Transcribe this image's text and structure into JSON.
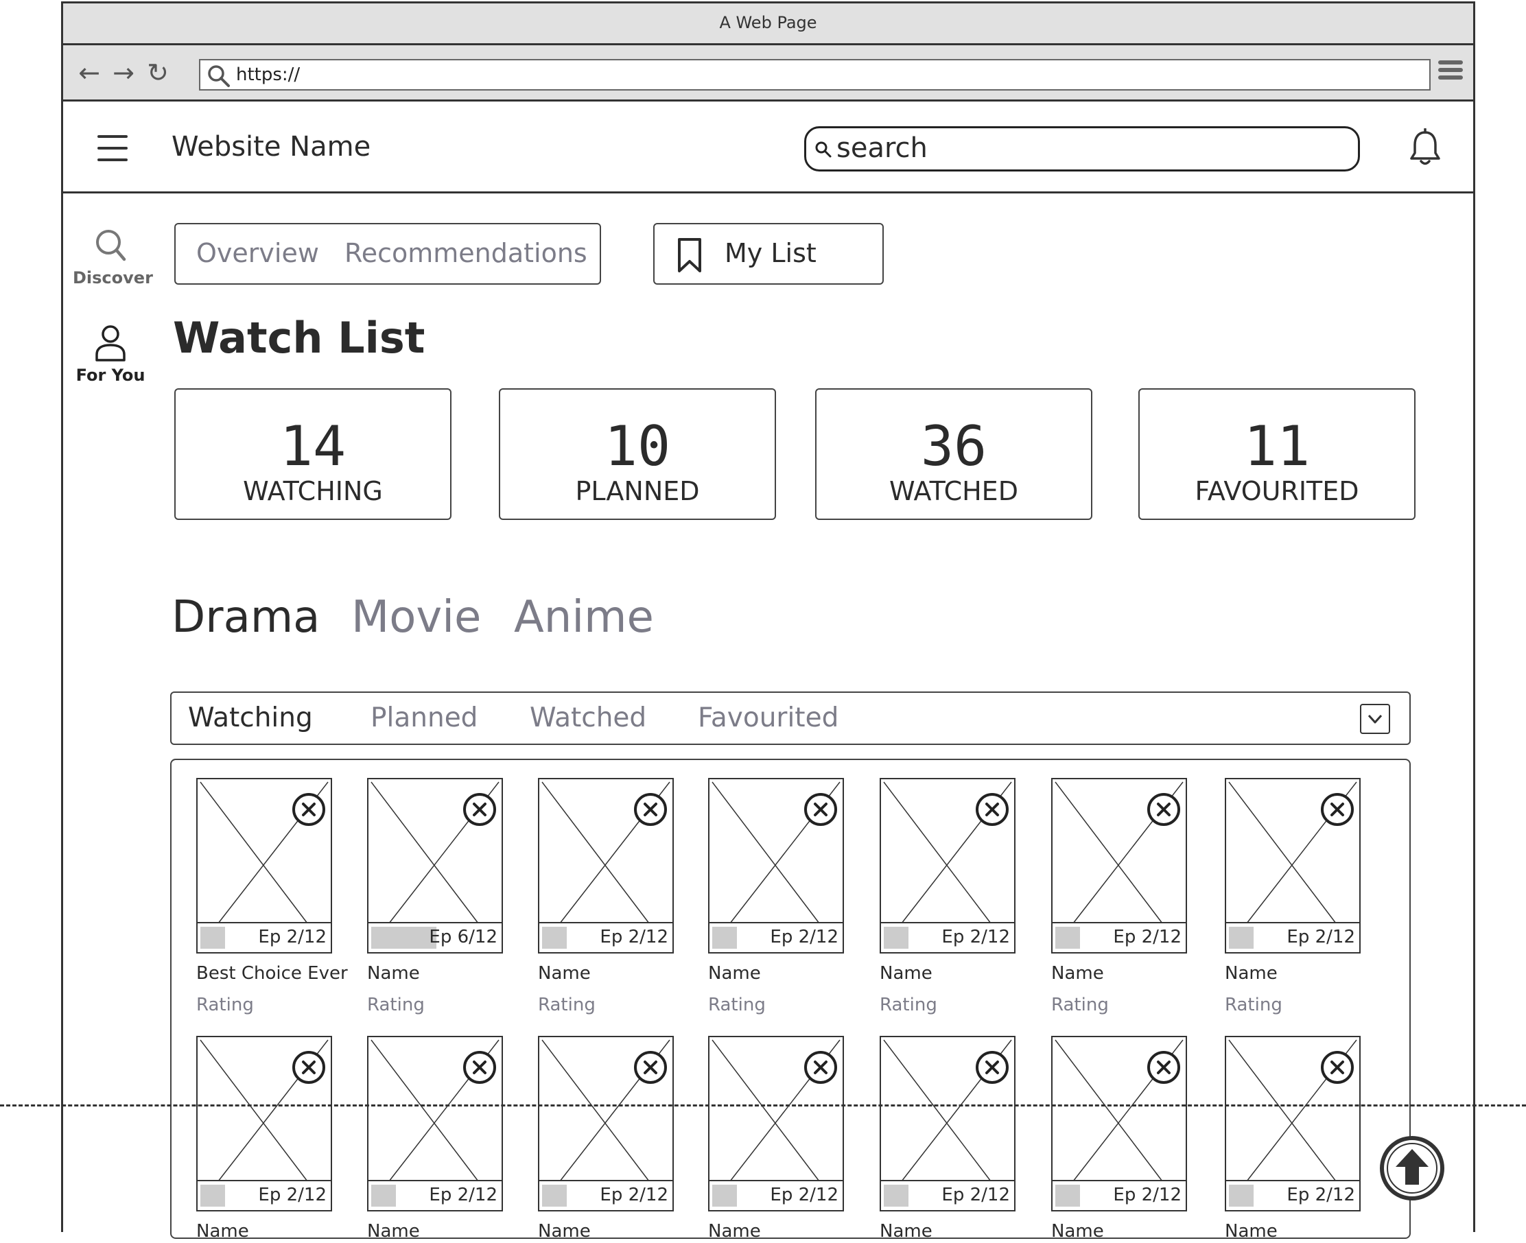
{
  "browser": {
    "window_title": "A Web Page",
    "url": "https://"
  },
  "header": {
    "site_name": "Website Name",
    "search_placeholder": "search"
  },
  "rail": {
    "items": [
      {
        "label": "Discover",
        "icon": "search-icon"
      },
      {
        "label": "For You",
        "icon": "user-icon"
      }
    ]
  },
  "top_tabs": {
    "overview": "Overview",
    "recommendations": "Recommendations",
    "my_list": "My List"
  },
  "page_title": "Watch List",
  "stats": [
    {
      "value": "14",
      "label": "WATCHING"
    },
    {
      "value": "10",
      "label": "PLANNED"
    },
    {
      "value": "36",
      "label": "WATCHED"
    },
    {
      "value": "11",
      "label": "FAVOURITED"
    }
  ],
  "categories": [
    "Drama",
    "Movie",
    "Anime"
  ],
  "active_category": "Drama",
  "status_tabs": [
    "Watching",
    "Planned",
    "Watched",
    "Favourited"
  ],
  "active_status_tab": "Watching",
  "grid": {
    "row1": [
      {
        "name": "Best Choice Ever",
        "rating": "Rating",
        "episode": "Ep 2/12",
        "progress": 0.17
      },
      {
        "name": "Name",
        "rating": "Rating",
        "episode": "Ep 6/12",
        "progress": 0.5
      },
      {
        "name": "Name",
        "rating": "Rating",
        "episode": "Ep 2/12",
        "progress": 0.17
      },
      {
        "name": "Name",
        "rating": "Rating",
        "episode": "Ep 2/12",
        "progress": 0.17
      },
      {
        "name": "Name",
        "rating": "Rating",
        "episode": "Ep 2/12",
        "progress": 0.17
      },
      {
        "name": "Name",
        "rating": "Rating",
        "episode": "Ep 2/12",
        "progress": 0.17
      },
      {
        "name": "Name",
        "rating": "Rating",
        "episode": "Ep 2/12",
        "progress": 0.17
      }
    ],
    "row2": [
      {
        "name": "Name",
        "episode": "Ep 2/12",
        "progress": 0.17
      },
      {
        "name": "Name",
        "episode": "Ep 2/12",
        "progress": 0.17
      },
      {
        "name": "Name",
        "episode": "Ep 2/12",
        "progress": 0.17
      },
      {
        "name": "Name",
        "episode": "Ep 2/12",
        "progress": 0.17
      },
      {
        "name": "Name",
        "episode": "Ep 2/12",
        "progress": 0.17
      },
      {
        "name": "Name",
        "episode": "Ep 2/12",
        "progress": 0.17
      },
      {
        "name": "Name",
        "episode": "Ep 2/12",
        "progress": 0.17
      }
    ]
  },
  "colors": {
    "frame": "#333333",
    "chrome": "#e1e1e1",
    "muted_text": "#7c7c88",
    "progress_fill": "#cccccc"
  }
}
